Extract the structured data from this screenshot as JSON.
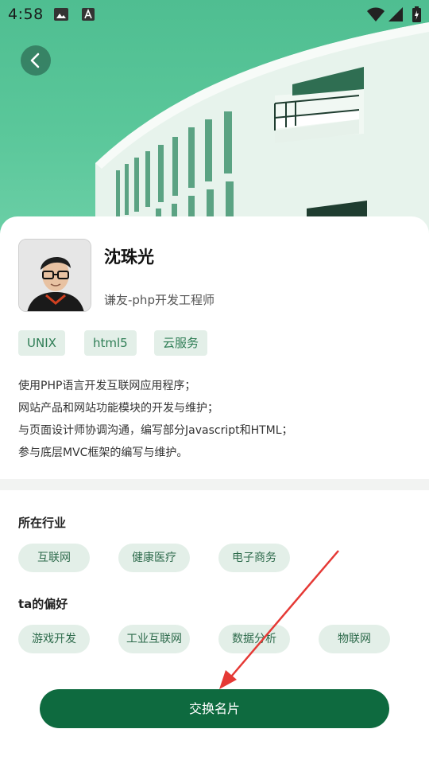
{
  "status_bar": {
    "time": "4:58"
  },
  "profile": {
    "name": "沈珠光",
    "title": "谦友-php开发工程师",
    "tags": [
      "UNIX",
      "html5",
      "云服务"
    ],
    "description": [
      "使用PHP语言开发互联网应用程序；",
      "网站产品和网站功能模块的开发与维护；",
      "与页面设计师协调沟通，编写部分Javascript和HTML；",
      "参与底层MVC框架的编写与维护。"
    ]
  },
  "industry": {
    "title": "所在行业",
    "items": [
      "互联网",
      "健康医疗",
      "电子商务"
    ]
  },
  "preferences": {
    "title": "ta的偏好",
    "items": [
      "游戏开发",
      "工业互联网",
      "数据分析",
      "物联网"
    ]
  },
  "action": {
    "label": "交换名片"
  },
  "colors": {
    "accent": "#0e6a3f",
    "hero": "#5ac79a",
    "chip_bg": "#e3efe8",
    "arrow": "#e53935"
  }
}
